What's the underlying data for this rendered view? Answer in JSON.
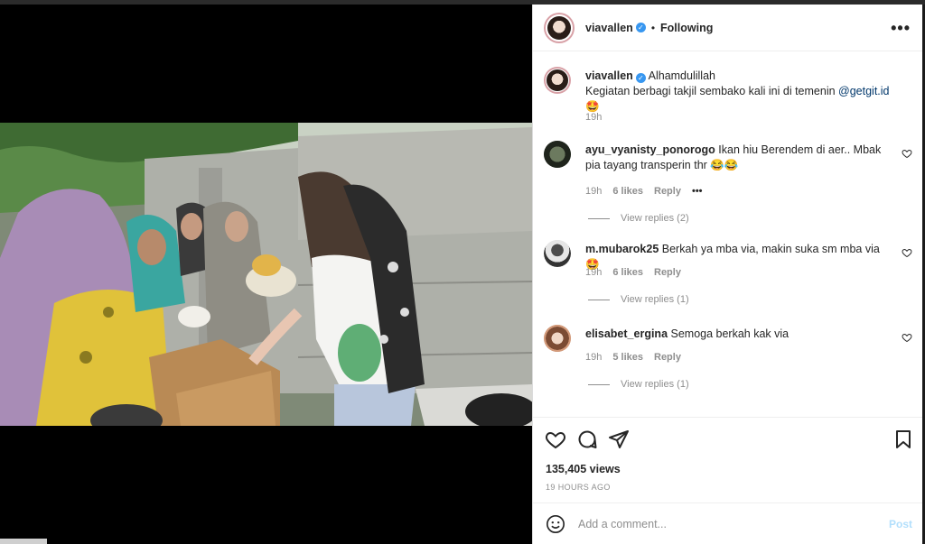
{
  "header": {
    "username": "viavallen",
    "separator": "•",
    "follow_status": "Following",
    "more_label": "•••"
  },
  "caption": {
    "username": "viavallen",
    "text_line1": "Alhamdulillah",
    "text_line2_prefix": "Kegiatan berbagi takjil sembako kali ini di temenin ",
    "mention": "@getgit.id",
    "emoji": "🤩",
    "time": "19h"
  },
  "comments": [
    {
      "username": "ayu_vyanisty_ponorogo",
      "text": "Ikan hiu Berendem di aer.. Mbak pia tayang transperin thr 😂😂",
      "time": "19h",
      "likes": "6 likes",
      "reply": "Reply",
      "more": "•••",
      "view_replies": "View replies (2)"
    },
    {
      "username": "m.mubarok25",
      "text": "Berkah ya mba via, makin suka sm mba via🤩",
      "time": "19h",
      "likes": "6 likes",
      "reply": "Reply",
      "view_replies": "View replies (1)"
    },
    {
      "username": "elisabet_ergina",
      "text": "Semoga berkah kak via",
      "time": "19h",
      "likes": "5 likes",
      "reply": "Reply",
      "view_replies": "View replies (1)"
    }
  ],
  "stats": {
    "views": "135,405 views",
    "timestamp": "19 HOURS AGO"
  },
  "add_comment": {
    "placeholder": "Add a comment...",
    "post_label": "Post"
  },
  "colors": {
    "verified": "#3897f0",
    "link": "#00376b",
    "post_disabled": "#b2dffc",
    "meta_gray": "#8e8e8e"
  }
}
